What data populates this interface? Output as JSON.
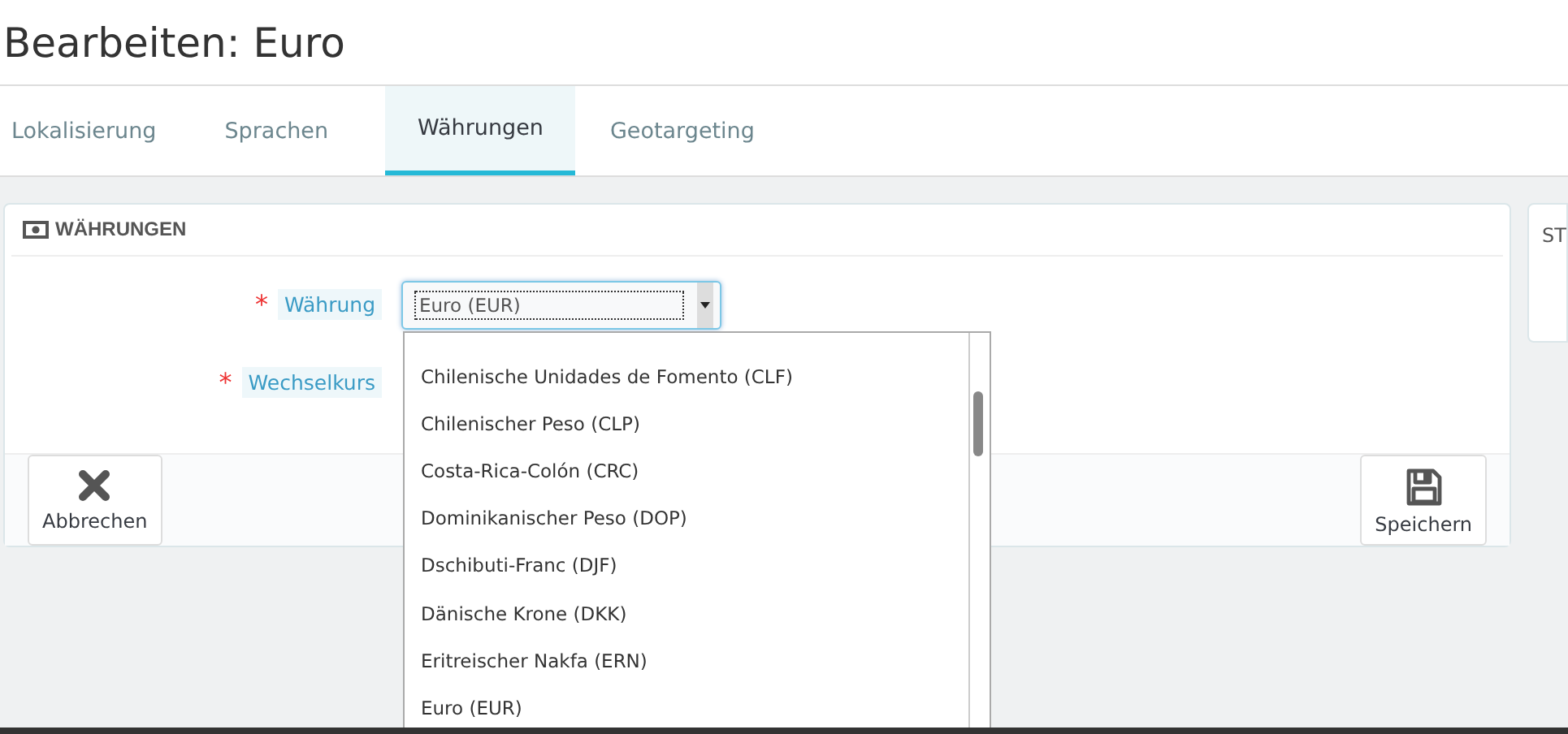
{
  "page_title": "Bearbeiten: Euro",
  "tabs": [
    {
      "label": "Lokalisierung",
      "selected": false
    },
    {
      "label": "Sprachen",
      "selected": false
    },
    {
      "label": "Währungen",
      "selected": true
    },
    {
      "label": "Geotargeting",
      "selected": false
    }
  ],
  "panel": {
    "heading": "WÄHRUNGEN",
    "fields": [
      {
        "label": "Währung",
        "required_mark": "*",
        "value": "Euro (EUR)"
      },
      {
        "label": "Wechselkurs",
        "required_mark": "*"
      }
    ],
    "dropdown_options": [
      "Chilenische Unidades de Fomento (CLF)",
      "Chilenischer Peso (CLP)",
      "Costa-Rica-Colón (CRC)",
      "Dominikanischer Peso (DOP)",
      "Dschibuti-Franc (DJF)",
      "Dänische Krone (DKK)",
      "Eritreischer Nakfa (ERN)",
      "Euro (EUR)"
    ],
    "buttons": [
      {
        "label": "Abbrechen",
        "kind": "cancel"
      },
      {
        "label": "Speichern",
        "kind": "save"
      }
    ]
  },
  "side_panel": {
    "heading": "ST"
  }
}
